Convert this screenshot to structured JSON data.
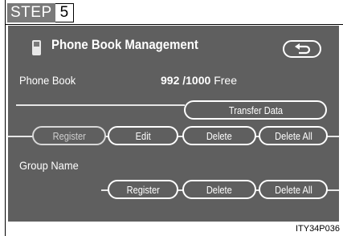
{
  "step": {
    "word": "STEP",
    "number": "5"
  },
  "screen": {
    "title": "Phone Book Management",
    "phone_book_label": "Phone Book",
    "phone_book_count": "992 /1000",
    "phone_book_free": "Free",
    "transfer_button": "Transfer Data",
    "register_button": "Register",
    "edit_button": "Edit",
    "delete_button": "Delete",
    "delete_all_button": "Delete All",
    "group_name_label": "Group Name",
    "group_register_button": "Register",
    "group_delete_button": "Delete",
    "group_delete_all_button": "Delete All"
  },
  "icons": {
    "title_icon": "phone-icon",
    "back_icon": "back-arrow-icon"
  },
  "caption": "ITY34P036",
  "colors": {
    "screen_bg": "#5f5f5f",
    "step_bg": "#7a7a7a"
  }
}
